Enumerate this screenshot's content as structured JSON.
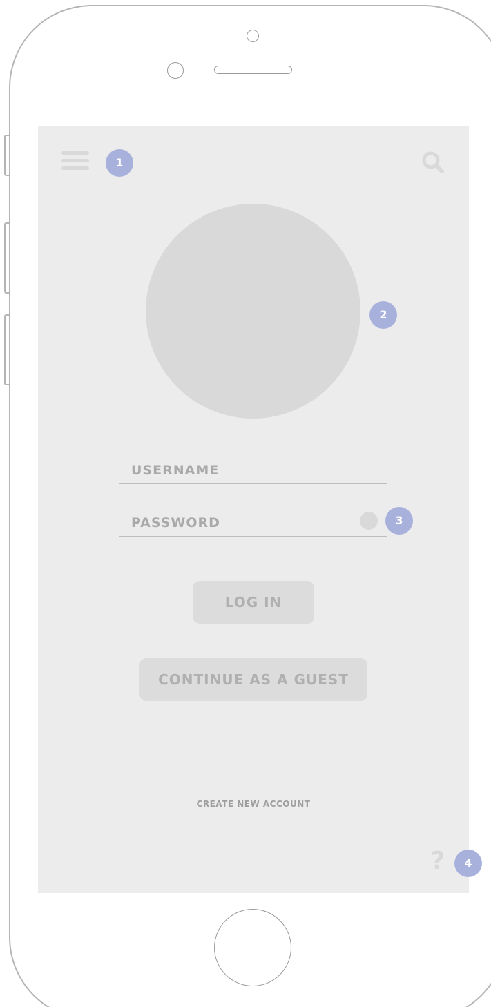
{
  "login": {
    "username_placeholder": "USERNAME",
    "password_placeholder": "PASSWORD",
    "login_label": "LOG IN",
    "guest_label": "CONTINUE AS A GUEST",
    "create_account_label": "CREATE NEW ACCOUNT"
  },
  "icons": {
    "menu": "hamburger-menu-icon",
    "search": "search-icon",
    "password_toggle": "show-password-toggle-icon",
    "help": "question-mark-icon",
    "help_glyph": "?"
  },
  "annotations": [
    "1",
    "2",
    "3",
    "4"
  ],
  "colors": {
    "screen_background": "#ececec",
    "placeholder_gray": "#d9d9d9",
    "text_gray": "#a9a9a9",
    "button_background": "#dcdcdc",
    "badge_blue": "#a7b1dc",
    "device_outline": "#b5b5b5"
  }
}
